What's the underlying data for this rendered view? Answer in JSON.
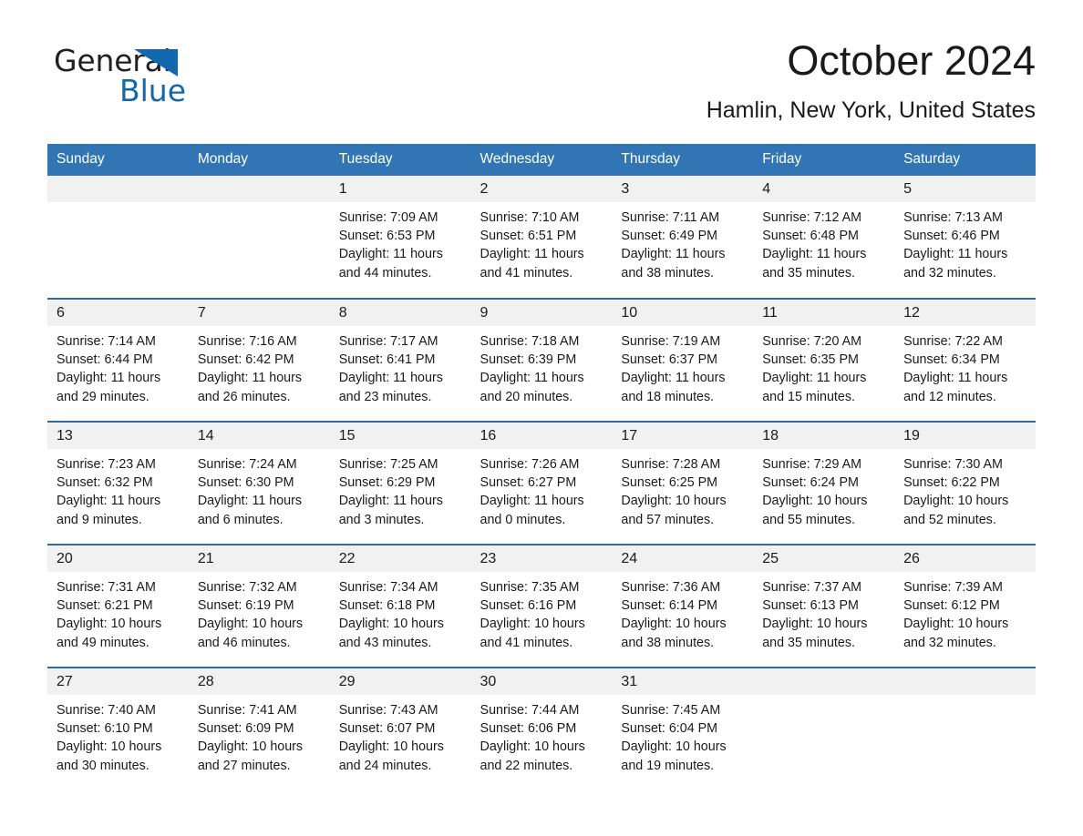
{
  "brand": {
    "name_part1": "General",
    "name_part2": "Blue",
    "logo_triangle_color": "#1168ad",
    "accent_color": "#3275b5"
  },
  "header": {
    "title": "October 2024",
    "subtitle": "Hamlin, New York, United States"
  },
  "calendar": {
    "weekday_headers": [
      "Sunday",
      "Monday",
      "Tuesday",
      "Wednesday",
      "Thursday",
      "Friday",
      "Saturday"
    ],
    "header_bg": "#3275b5",
    "daynum_bg": "#f1f1f1",
    "row_border_color": "#2e6da4",
    "weeks": [
      [
        {
          "day": "",
          "empty": true,
          "sunrise": "",
          "sunset": "",
          "daylight_line1": "",
          "daylight_line2": ""
        },
        {
          "day": "",
          "empty": true,
          "sunrise": "",
          "sunset": "",
          "daylight_line1": "",
          "daylight_line2": ""
        },
        {
          "day": "1",
          "empty": false,
          "sunrise": "Sunrise: 7:09 AM",
          "sunset": "Sunset: 6:53 PM",
          "daylight_line1": "Daylight: 11 hours",
          "daylight_line2": "and 44 minutes."
        },
        {
          "day": "2",
          "empty": false,
          "sunrise": "Sunrise: 7:10 AM",
          "sunset": "Sunset: 6:51 PM",
          "daylight_line1": "Daylight: 11 hours",
          "daylight_line2": "and 41 minutes."
        },
        {
          "day": "3",
          "empty": false,
          "sunrise": "Sunrise: 7:11 AM",
          "sunset": "Sunset: 6:49 PM",
          "daylight_line1": "Daylight: 11 hours",
          "daylight_line2": "and 38 minutes."
        },
        {
          "day": "4",
          "empty": false,
          "sunrise": "Sunrise: 7:12 AM",
          "sunset": "Sunset: 6:48 PM",
          "daylight_line1": "Daylight: 11 hours",
          "daylight_line2": "and 35 minutes."
        },
        {
          "day": "5",
          "empty": false,
          "sunrise": "Sunrise: 7:13 AM",
          "sunset": "Sunset: 6:46 PM",
          "daylight_line1": "Daylight: 11 hours",
          "daylight_line2": "and 32 minutes."
        }
      ],
      [
        {
          "day": "6",
          "empty": false,
          "sunrise": "Sunrise: 7:14 AM",
          "sunset": "Sunset: 6:44 PM",
          "daylight_line1": "Daylight: 11 hours",
          "daylight_line2": "and 29 minutes."
        },
        {
          "day": "7",
          "empty": false,
          "sunrise": "Sunrise: 7:16 AM",
          "sunset": "Sunset: 6:42 PM",
          "daylight_line1": "Daylight: 11 hours",
          "daylight_line2": "and 26 minutes."
        },
        {
          "day": "8",
          "empty": false,
          "sunrise": "Sunrise: 7:17 AM",
          "sunset": "Sunset: 6:41 PM",
          "daylight_line1": "Daylight: 11 hours",
          "daylight_line2": "and 23 minutes."
        },
        {
          "day": "9",
          "empty": false,
          "sunrise": "Sunrise: 7:18 AM",
          "sunset": "Sunset: 6:39 PM",
          "daylight_line1": "Daylight: 11 hours",
          "daylight_line2": "and 20 minutes."
        },
        {
          "day": "10",
          "empty": false,
          "sunrise": "Sunrise: 7:19 AM",
          "sunset": "Sunset: 6:37 PM",
          "daylight_line1": "Daylight: 11 hours",
          "daylight_line2": "and 18 minutes."
        },
        {
          "day": "11",
          "empty": false,
          "sunrise": "Sunrise: 7:20 AM",
          "sunset": "Sunset: 6:35 PM",
          "daylight_line1": "Daylight: 11 hours",
          "daylight_line2": "and 15 minutes."
        },
        {
          "day": "12",
          "empty": false,
          "sunrise": "Sunrise: 7:22 AM",
          "sunset": "Sunset: 6:34 PM",
          "daylight_line1": "Daylight: 11 hours",
          "daylight_line2": "and 12 minutes."
        }
      ],
      [
        {
          "day": "13",
          "empty": false,
          "sunrise": "Sunrise: 7:23 AM",
          "sunset": "Sunset: 6:32 PM",
          "daylight_line1": "Daylight: 11 hours",
          "daylight_line2": "and 9 minutes."
        },
        {
          "day": "14",
          "empty": false,
          "sunrise": "Sunrise: 7:24 AM",
          "sunset": "Sunset: 6:30 PM",
          "daylight_line1": "Daylight: 11 hours",
          "daylight_line2": "and 6 minutes."
        },
        {
          "day": "15",
          "empty": false,
          "sunrise": "Sunrise: 7:25 AM",
          "sunset": "Sunset: 6:29 PM",
          "daylight_line1": "Daylight: 11 hours",
          "daylight_line2": "and 3 minutes."
        },
        {
          "day": "16",
          "empty": false,
          "sunrise": "Sunrise: 7:26 AM",
          "sunset": "Sunset: 6:27 PM",
          "daylight_line1": "Daylight: 11 hours",
          "daylight_line2": "and 0 minutes."
        },
        {
          "day": "17",
          "empty": false,
          "sunrise": "Sunrise: 7:28 AM",
          "sunset": "Sunset: 6:25 PM",
          "daylight_line1": "Daylight: 10 hours",
          "daylight_line2": "and 57 minutes."
        },
        {
          "day": "18",
          "empty": false,
          "sunrise": "Sunrise: 7:29 AM",
          "sunset": "Sunset: 6:24 PM",
          "daylight_line1": "Daylight: 10 hours",
          "daylight_line2": "and 55 minutes."
        },
        {
          "day": "19",
          "empty": false,
          "sunrise": "Sunrise: 7:30 AM",
          "sunset": "Sunset: 6:22 PM",
          "daylight_line1": "Daylight: 10 hours",
          "daylight_line2": "and 52 minutes."
        }
      ],
      [
        {
          "day": "20",
          "empty": false,
          "sunrise": "Sunrise: 7:31 AM",
          "sunset": "Sunset: 6:21 PM",
          "daylight_line1": "Daylight: 10 hours",
          "daylight_line2": "and 49 minutes."
        },
        {
          "day": "21",
          "empty": false,
          "sunrise": "Sunrise: 7:32 AM",
          "sunset": "Sunset: 6:19 PM",
          "daylight_line1": "Daylight: 10 hours",
          "daylight_line2": "and 46 minutes."
        },
        {
          "day": "22",
          "empty": false,
          "sunrise": "Sunrise: 7:34 AM",
          "sunset": "Sunset: 6:18 PM",
          "daylight_line1": "Daylight: 10 hours",
          "daylight_line2": "and 43 minutes."
        },
        {
          "day": "23",
          "empty": false,
          "sunrise": "Sunrise: 7:35 AM",
          "sunset": "Sunset: 6:16 PM",
          "daylight_line1": "Daylight: 10 hours",
          "daylight_line2": "and 41 minutes."
        },
        {
          "day": "24",
          "empty": false,
          "sunrise": "Sunrise: 7:36 AM",
          "sunset": "Sunset: 6:14 PM",
          "daylight_line1": "Daylight: 10 hours",
          "daylight_line2": "and 38 minutes."
        },
        {
          "day": "25",
          "empty": false,
          "sunrise": "Sunrise: 7:37 AM",
          "sunset": "Sunset: 6:13 PM",
          "daylight_line1": "Daylight: 10 hours",
          "daylight_line2": "and 35 minutes."
        },
        {
          "day": "26",
          "empty": false,
          "sunrise": "Sunrise: 7:39 AM",
          "sunset": "Sunset: 6:12 PM",
          "daylight_line1": "Daylight: 10 hours",
          "daylight_line2": "and 32 minutes."
        }
      ],
      [
        {
          "day": "27",
          "empty": false,
          "sunrise": "Sunrise: 7:40 AM",
          "sunset": "Sunset: 6:10 PM",
          "daylight_line1": "Daylight: 10 hours",
          "daylight_line2": "and 30 minutes."
        },
        {
          "day": "28",
          "empty": false,
          "sunrise": "Sunrise: 7:41 AM",
          "sunset": "Sunset: 6:09 PM",
          "daylight_line1": "Daylight: 10 hours",
          "daylight_line2": "and 27 minutes."
        },
        {
          "day": "29",
          "empty": false,
          "sunrise": "Sunrise: 7:43 AM",
          "sunset": "Sunset: 6:07 PM",
          "daylight_line1": "Daylight: 10 hours",
          "daylight_line2": "and 24 minutes."
        },
        {
          "day": "30",
          "empty": false,
          "sunrise": "Sunrise: 7:44 AM",
          "sunset": "Sunset: 6:06 PM",
          "daylight_line1": "Daylight: 10 hours",
          "daylight_line2": "and 22 minutes."
        },
        {
          "day": "31",
          "empty": false,
          "sunrise": "Sunrise: 7:45 AM",
          "sunset": "Sunset: 6:04 PM",
          "daylight_line1": "Daylight: 10 hours",
          "daylight_line2": "and 19 minutes."
        },
        {
          "day": "",
          "empty": true,
          "sunrise": "",
          "sunset": "",
          "daylight_line1": "",
          "daylight_line2": ""
        },
        {
          "day": "",
          "empty": true,
          "sunrise": "",
          "sunset": "",
          "daylight_line1": "",
          "daylight_line2": ""
        }
      ]
    ]
  }
}
